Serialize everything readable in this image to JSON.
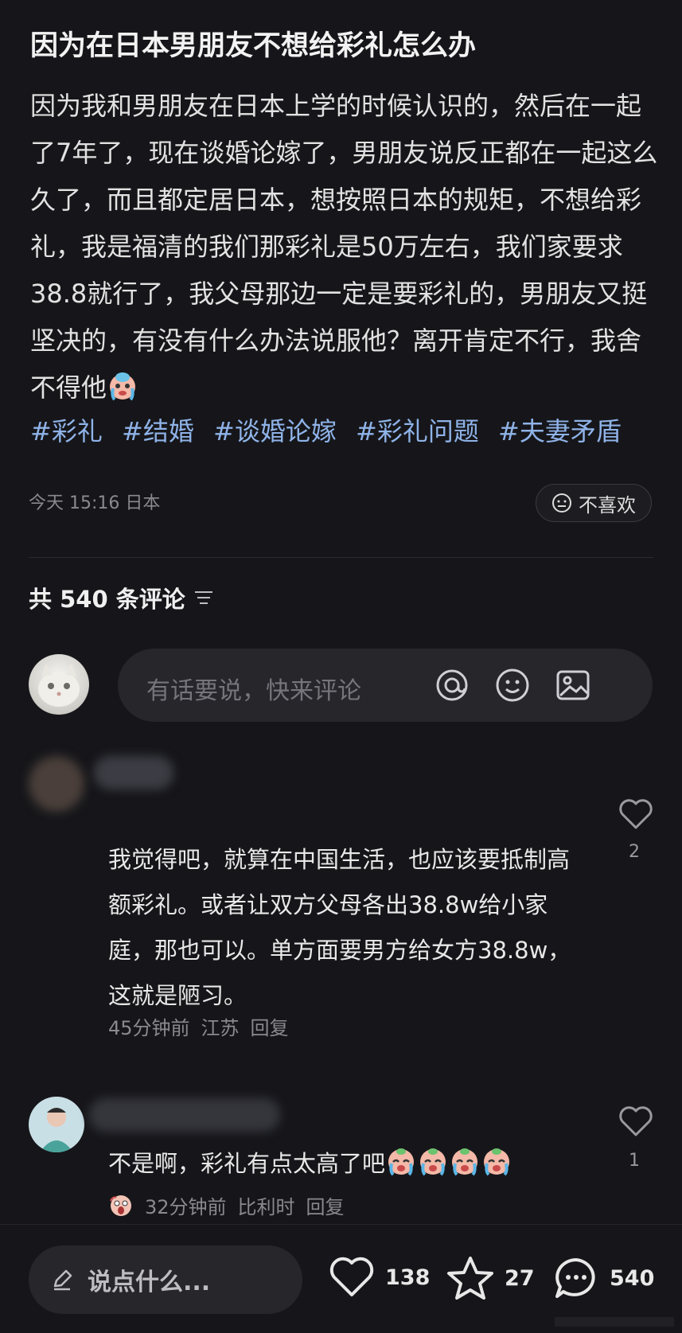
{
  "post": {
    "title": "因为在日本男朋友不想给彩礼怎么办",
    "body": "因为我和男朋友在日本上学的时候认识的，然后在一起了7年了，现在谈婚论嫁了，男朋友说反正都在一起这么久了，而且都定居日本，想按照日本的规矩，不想给彩礼，我是福清的我们那彩礼是50万左右，我们家要求38.8就行了，我父母那边一定是要彩礼的，男朋友又挺坚决的，有没有什么办法说服他？离开肯定不行，我舍不得他",
    "tags": [
      "#彩礼",
      "#结婚",
      "#谈婚论嫁",
      "#彩礼问题",
      "#夫妻矛盾"
    ],
    "time": "今天 15:16 日本",
    "dislike_label": "不喜欢"
  },
  "comments_header": {
    "label": "共 540 条评论"
  },
  "comment_input": {
    "placeholder": "有话要说，快来评论"
  },
  "comments": [
    {
      "text": "我觉得吧，就算在中国生活，也应该要抵制高额彩礼。或者让双方父母各出38.8w给小家庭，那也可以。单方面要男方给女方38.8w，这就是陋习。",
      "time": "45分钟前",
      "location": "江苏",
      "reply": "回复",
      "likes": "2"
    },
    {
      "text": "不是啊，彩礼有点太高了吧",
      "time": "32分钟前",
      "location": "比利时",
      "reply": "回复",
      "likes": "1"
    }
  ],
  "bottom_bar": {
    "say_placeholder": "说点什么...",
    "likes": "138",
    "favorites": "27",
    "comments": "540"
  },
  "colors": {
    "background": "#16161a",
    "tag": "#8fb3e8",
    "muted": "#8a8a8e"
  }
}
